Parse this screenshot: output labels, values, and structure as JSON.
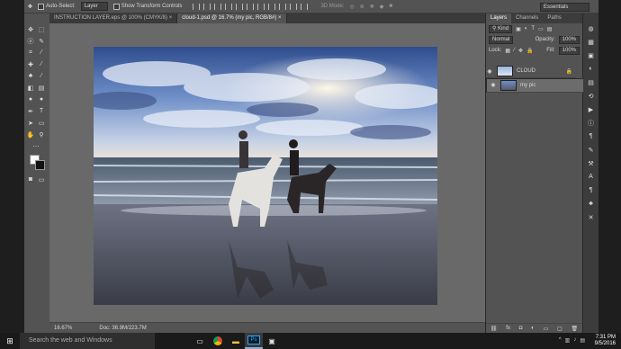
{
  "options_bar": {
    "auto_select_label": "Auto-Select:",
    "auto_select_target": "Layer",
    "show_transform_label": "Show Transform Controls",
    "mode_3d": "3D Mode:",
    "workspace": "Essentials"
  },
  "tabs": [
    {
      "label": "INSTRUCTION LAYER.eps @ 100% (CMYK/8)",
      "close": "×"
    },
    {
      "label": "cloud-1.psd @ 16.7% (my pic, RGB/8#)",
      "close": "×"
    }
  ],
  "status": {
    "zoom": "16.67%",
    "doc_size": "Doc: 36.9M/223.7M"
  },
  "panels": {
    "tabs": [
      "Layers",
      "Channels",
      "Paths"
    ],
    "filter_kind": "Kind",
    "blend_mode": "Normal",
    "opacity_label": "Opacity:",
    "opacity_value": "100%",
    "lock_label": "Lock:",
    "fill_label": "Fill:",
    "fill_value": "100%",
    "layers": [
      {
        "name": "CLOUD",
        "visible": true,
        "locked": true,
        "selected": false
      },
      {
        "name": "my pic",
        "visible": true,
        "locked": false,
        "selected": true
      }
    ]
  },
  "taskbar": {
    "search_placeholder": "Search the web and Windows",
    "time": "7:31 PM",
    "date": "9/5/2016",
    "apps": [
      "task-view",
      "chrome",
      "file-explorer",
      "photoshop",
      "image-app"
    ]
  },
  "colors": {
    "ui_panel": "#535353",
    "canvas_bg": "#696969",
    "selected_layer": "#6c6c6c",
    "ps_blue": "#31a8ff"
  }
}
